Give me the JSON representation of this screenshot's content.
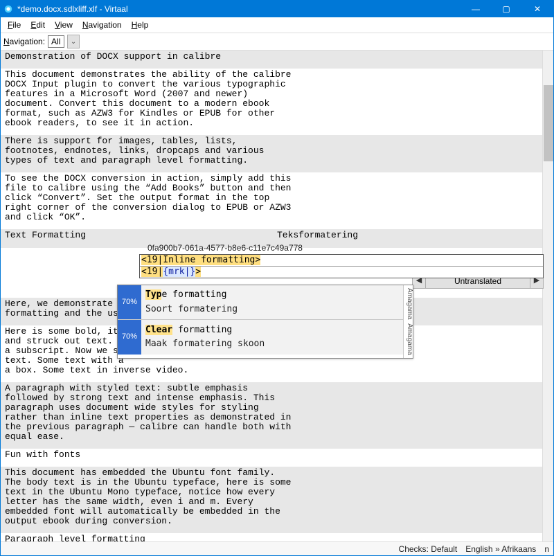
{
  "window": {
    "title": "*demo.docx.sdlxliff.xlf - Virtaal",
    "min_label": "—",
    "max_label": "▢",
    "close_label": "✕"
  },
  "menubar": {
    "file": "File",
    "edit": "Edit",
    "view": "View",
    "navigation": "Navigation",
    "help": "Help"
  },
  "navrow": {
    "label": "Navigation:",
    "value": "All"
  },
  "segments": [
    {
      "idx": 0,
      "style": "dark",
      "text": "Demonstration of DOCX support in calibre"
    },
    {
      "idx": 1,
      "style": "light",
      "text": "This document demonstrates the ability of the calibre\nDOCX Input plugin to convert the various typographic\nfeatures in a Microsoft Word (2007 and newer)\ndocument. Convert this document to a modern ebook\nformat, such as AZW3 for Kindles or EPUB for other\nebook readers, to see it in action."
    },
    {
      "idx": 2,
      "style": "dark",
      "text": "There is support for images, tables, lists,\nfootnotes, endnotes, links, dropcaps and various\ntypes of text and paragraph level formatting."
    },
    {
      "idx": 3,
      "style": "light",
      "text": "To see the DOCX conversion in action, simply add this\nfile to calibre using the “Add Books” button and then\nclick “Convert”. Set the output format in the top\nright corner of the conversion dialog to EPUB or AZW3\nand click “OK”."
    },
    {
      "idx": 4,
      "style": "dark",
      "twoCol": true,
      "src": "Text Formatting",
      "tgt": "Teksformatering"
    },
    {
      "idx": 5,
      "style": "light",
      "text": "\n\n\n"
    },
    {
      "idx": 6,
      "style": "dark",
      "text": "Here, we demonstrate va\nformatting and the use\n"
    },
    {
      "idx": 7,
      "style": "light",
      "text": "Here is some bold, ital\nand struck out text. Th\na subscript. Now we see\ntext. Some text with a\na box. Some text in inverse video."
    },
    {
      "idx": 8,
      "style": "dark",
      "text": "A paragraph with styled text: subtle emphasis\nfollowed by strong text and intense emphasis. This\nparagraph uses document wide styles for styling\nrather than inline text properties as demonstrated in\nthe previous paragraph — calibre can handle both with\nequal ease."
    },
    {
      "idx": 9,
      "style": "light",
      "text": "Fun with fonts"
    },
    {
      "idx": 10,
      "style": "dark",
      "text": "This document has embedded the Ubuntu font family.\nThe body text is in the Ubuntu typeface, here is some\ntext in the Ubuntu Mono typeface, notice how every\nletter has the same width, even i and m. Every\nembedded font will automatically be embedded in the\noutput ebook during conversion."
    },
    {
      "idx": 11,
      "style": "light",
      "text": "Paragraph level formatting"
    }
  ],
  "editor": {
    "unit_id": "0fa900b7-061a-4577-b8e6-c11e7c49a778",
    "src_prefix": "<19|",
    "src_text": "Inline formatting",
    "src_suffix": ">",
    "tgt_prefix": "<19|",
    "tgt_mrk": "{mrk|}",
    "tgt_suffix": ">"
  },
  "nav_buttons": {
    "prev": "◀",
    "label": "Untranslated",
    "next": "▶"
  },
  "suggestions": [
    {
      "pct": "70%",
      "match": "Typ",
      "rest": "e formatting",
      "target": "Soort formatering",
      "provider": "Amagama"
    },
    {
      "pct": "70%",
      "match": "Clear",
      "rest": " formatting",
      "target": "Maak formatering skoon",
      "provider": "Amagama"
    }
  ],
  "status": {
    "checks": "Checks: Default",
    "lang": "English » Afrikaans",
    "extra": "n"
  }
}
